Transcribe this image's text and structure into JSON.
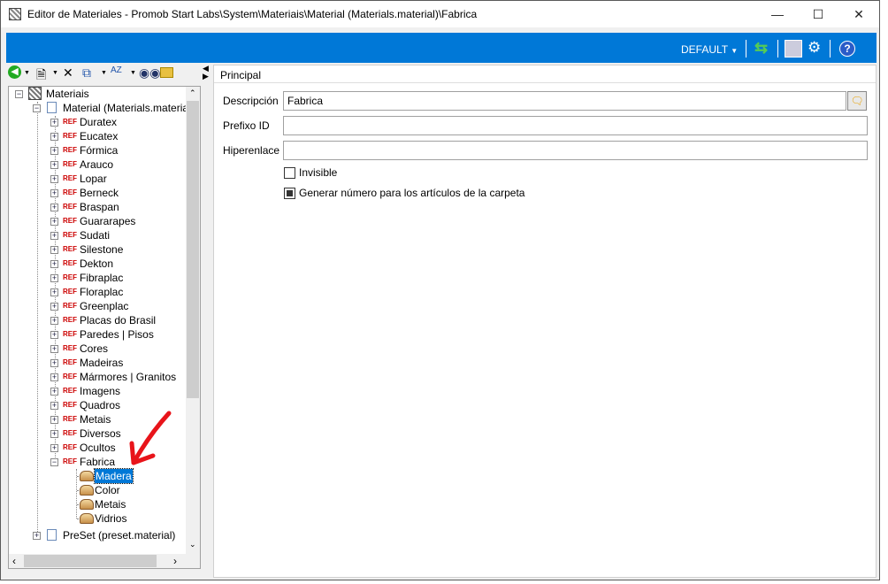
{
  "window": {
    "title": "Editor de Materiales - Promob Start Labs\\System\\Materiais\\Material (Materials.material)\\Fabrica"
  },
  "topbar": {
    "profile": "DEFAULT",
    "colors": {
      "bar": "#0078d7"
    }
  },
  "tree": {
    "root": "Materiais",
    "file": "Material (Materials.material)",
    "ref_badge": "REF",
    "items": [
      "Duratex",
      "Eucatex",
      "Fórmica",
      "Arauco",
      "Lopar",
      "Berneck",
      "Braspan",
      "Guararapes",
      "Sudati",
      "Silestone",
      "Dekton",
      "Fibraplac",
      "Floraplac",
      "Greenplac",
      "Placas do Brasil",
      "Paredes | Pisos",
      "Cores",
      "Madeiras",
      "Mármores | Granitos",
      "Imagens",
      "Quadros",
      "Metais",
      "Diversos",
      "Ocultos",
      "Fabrica"
    ],
    "children": [
      "Madera",
      "Color",
      "Metais",
      "Vidrios"
    ],
    "preset": "PreSet (preset.material)"
  },
  "panel": {
    "header": "Principal",
    "descripcion_label": "Descripción",
    "descripcion_value": "Fabrica",
    "prefijo_label": "Prefixo ID",
    "prefijo_value": "",
    "hiper_label": "Hiperenlace",
    "hiper_value": "",
    "invisible_label": "Invisible",
    "generar_label": "Generar número para los artículos de la carpeta"
  }
}
